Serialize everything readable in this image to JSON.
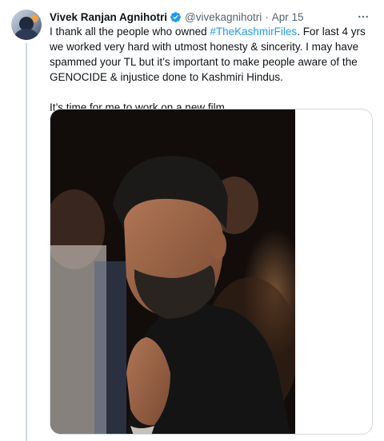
{
  "author": {
    "display_name": "Vivek Ranjan Agnihotri",
    "handle": "@vivekagnihotri",
    "separator": "·",
    "date": "Apr 15",
    "verified": true
  },
  "icons": {
    "more": "more-horizontal-icon",
    "verified": "verified-badge-icon",
    "verified_color": "#1d9bf0"
  },
  "tweet": {
    "text_before_hashtag": "I thank all the people who owned ",
    "hashtag": "#TheKashmirFiles",
    "text_after_hashtag": ". For last 4 yrs we worked very hard with utmost honesty & sincerity. I may have spammed your TL but it’s important to make people aware of the GENOCIDE & injustice done to Kashmiri Hindus.",
    "second_paragraph": "It’s time for me to work on a new film."
  },
  "colors": {
    "link": "#1d9bf0",
    "secondary_text": "#536471",
    "border": "#cfd9de"
  }
}
